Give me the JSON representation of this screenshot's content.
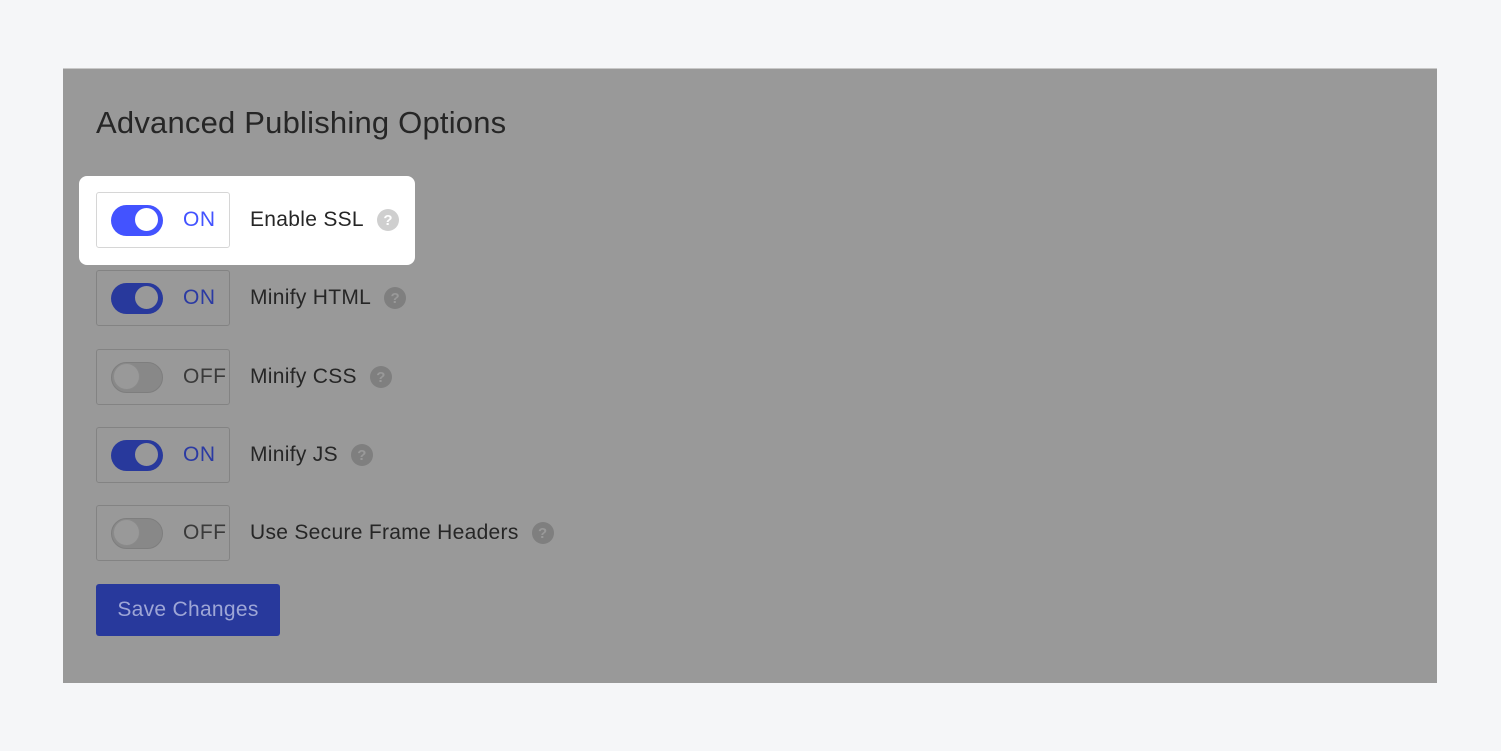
{
  "panel": {
    "title": "Advanced Publishing Options"
  },
  "options": [
    {
      "label": "Enable SSL",
      "state": "ON",
      "enabled": true,
      "highlighted": true,
      "help_icon": "question-circle-icon"
    },
    {
      "label": "Minify HTML",
      "state": "ON",
      "enabled": true,
      "highlighted": false,
      "help_icon": "question-circle-icon"
    },
    {
      "label": "Minify CSS",
      "state": "OFF",
      "enabled": false,
      "highlighted": false,
      "help_icon": "question-circle-icon"
    },
    {
      "label": "Minify JS",
      "state": "ON",
      "enabled": true,
      "highlighted": false,
      "help_icon": "question-circle-icon"
    },
    {
      "label": "Use Secure Frame Headers",
      "state": "OFF",
      "enabled": false,
      "highlighted": false,
      "help_icon": "question-circle-icon"
    }
  ],
  "help_glyph": "?",
  "save_button": {
    "label": "Save Changes"
  },
  "colors": {
    "accent": "#4353ff",
    "accent_dimmed": "#28399c",
    "overlay": "#999999",
    "page_background": "#f5f6f8"
  }
}
